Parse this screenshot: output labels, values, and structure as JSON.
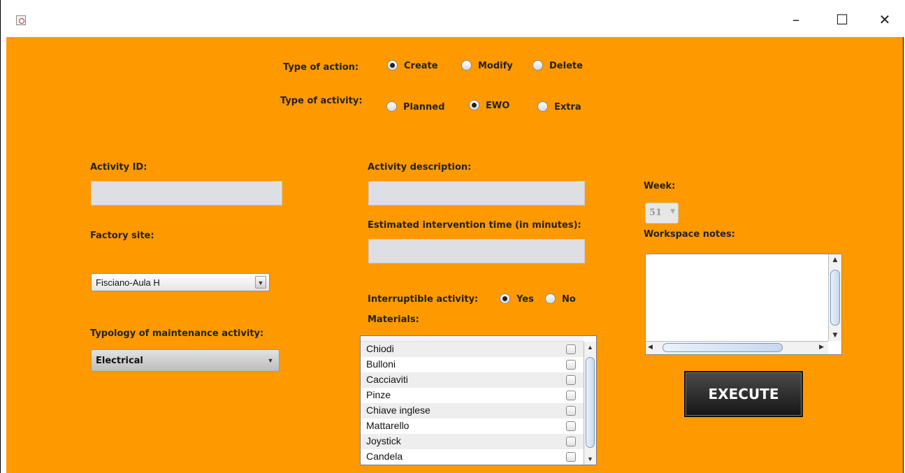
{
  "window": {
    "icon": "java-cup-icon",
    "controls": {
      "minimize": "–",
      "maximize": "☐",
      "close": "✕"
    }
  },
  "type_of_action": {
    "label": "Type of action:",
    "options": [
      {
        "label": "Create",
        "selected": true
      },
      {
        "label": "Modify",
        "selected": false
      },
      {
        "label": "Delete",
        "selected": false
      }
    ]
  },
  "type_of_activity": {
    "label": "Type of activity:",
    "options": [
      {
        "label": "Planned",
        "selected": false
      },
      {
        "label": "EWO",
        "selected": true
      },
      {
        "label": "Extra",
        "selected": false
      }
    ]
  },
  "activity_id": {
    "label": "Activity ID:",
    "value": ""
  },
  "factory_site": {
    "label": "Factory site:",
    "value": "Fisciano-Aula H"
  },
  "typology": {
    "label": "Typology of maintenance activity:",
    "value": "Electrical"
  },
  "activity_description": {
    "label": "Activity description:",
    "value": ""
  },
  "estimated_time": {
    "label": "Estimated intervention time (in minutes):",
    "value": ""
  },
  "interruptible": {
    "label": "Interruptible activity:",
    "options": [
      {
        "label": "Yes",
        "selected": true
      },
      {
        "label": "No",
        "selected": false
      }
    ]
  },
  "materials": {
    "label": "Materials:",
    "items": [
      "Chiodi",
      "Bulloni",
      "Cacciaviti",
      "Pinze",
      "Chiave inglese",
      "Mattarello",
      "Joystick",
      "Candela"
    ]
  },
  "week": {
    "label": "Week:",
    "value": "51"
  },
  "workspace_notes": {
    "label": "Workspace notes:",
    "value": ""
  },
  "execute_button": {
    "label": "EXECUTE"
  },
  "colors": {
    "background": "#ff9900",
    "field": "#dedfe5",
    "button": "#1e1e1e"
  }
}
